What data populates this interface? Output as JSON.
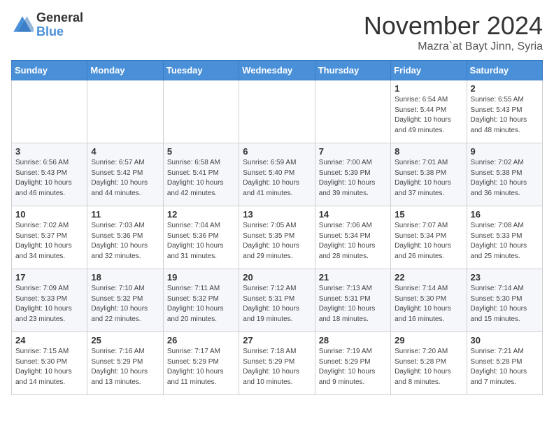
{
  "header": {
    "logo_general": "General",
    "logo_blue": "Blue",
    "month_title": "November 2024",
    "location": "Mazra`at Bayt Jinn, Syria"
  },
  "weekdays": [
    "Sunday",
    "Monday",
    "Tuesday",
    "Wednesday",
    "Thursday",
    "Friday",
    "Saturday"
  ],
  "weeks": [
    [
      {
        "day": "",
        "info": ""
      },
      {
        "day": "",
        "info": ""
      },
      {
        "day": "",
        "info": ""
      },
      {
        "day": "",
        "info": ""
      },
      {
        "day": "",
        "info": ""
      },
      {
        "day": "1",
        "info": "Sunrise: 6:54 AM\nSunset: 5:44 PM\nDaylight: 10 hours\nand 49 minutes."
      },
      {
        "day": "2",
        "info": "Sunrise: 6:55 AM\nSunset: 5:43 PM\nDaylight: 10 hours\nand 48 minutes."
      }
    ],
    [
      {
        "day": "3",
        "info": "Sunrise: 6:56 AM\nSunset: 5:43 PM\nDaylight: 10 hours\nand 46 minutes."
      },
      {
        "day": "4",
        "info": "Sunrise: 6:57 AM\nSunset: 5:42 PM\nDaylight: 10 hours\nand 44 minutes."
      },
      {
        "day": "5",
        "info": "Sunrise: 6:58 AM\nSunset: 5:41 PM\nDaylight: 10 hours\nand 42 minutes."
      },
      {
        "day": "6",
        "info": "Sunrise: 6:59 AM\nSunset: 5:40 PM\nDaylight: 10 hours\nand 41 minutes."
      },
      {
        "day": "7",
        "info": "Sunrise: 7:00 AM\nSunset: 5:39 PM\nDaylight: 10 hours\nand 39 minutes."
      },
      {
        "day": "8",
        "info": "Sunrise: 7:01 AM\nSunset: 5:38 PM\nDaylight: 10 hours\nand 37 minutes."
      },
      {
        "day": "9",
        "info": "Sunrise: 7:02 AM\nSunset: 5:38 PM\nDaylight: 10 hours\nand 36 minutes."
      }
    ],
    [
      {
        "day": "10",
        "info": "Sunrise: 7:02 AM\nSunset: 5:37 PM\nDaylight: 10 hours\nand 34 minutes."
      },
      {
        "day": "11",
        "info": "Sunrise: 7:03 AM\nSunset: 5:36 PM\nDaylight: 10 hours\nand 32 minutes."
      },
      {
        "day": "12",
        "info": "Sunrise: 7:04 AM\nSunset: 5:36 PM\nDaylight: 10 hours\nand 31 minutes."
      },
      {
        "day": "13",
        "info": "Sunrise: 7:05 AM\nSunset: 5:35 PM\nDaylight: 10 hours\nand 29 minutes."
      },
      {
        "day": "14",
        "info": "Sunrise: 7:06 AM\nSunset: 5:34 PM\nDaylight: 10 hours\nand 28 minutes."
      },
      {
        "day": "15",
        "info": "Sunrise: 7:07 AM\nSunset: 5:34 PM\nDaylight: 10 hours\nand 26 minutes."
      },
      {
        "day": "16",
        "info": "Sunrise: 7:08 AM\nSunset: 5:33 PM\nDaylight: 10 hours\nand 25 minutes."
      }
    ],
    [
      {
        "day": "17",
        "info": "Sunrise: 7:09 AM\nSunset: 5:33 PM\nDaylight: 10 hours\nand 23 minutes."
      },
      {
        "day": "18",
        "info": "Sunrise: 7:10 AM\nSunset: 5:32 PM\nDaylight: 10 hours\nand 22 minutes."
      },
      {
        "day": "19",
        "info": "Sunrise: 7:11 AM\nSunset: 5:32 PM\nDaylight: 10 hours\nand 20 minutes."
      },
      {
        "day": "20",
        "info": "Sunrise: 7:12 AM\nSunset: 5:31 PM\nDaylight: 10 hours\nand 19 minutes."
      },
      {
        "day": "21",
        "info": "Sunrise: 7:13 AM\nSunset: 5:31 PM\nDaylight: 10 hours\nand 18 minutes."
      },
      {
        "day": "22",
        "info": "Sunrise: 7:14 AM\nSunset: 5:30 PM\nDaylight: 10 hours\nand 16 minutes."
      },
      {
        "day": "23",
        "info": "Sunrise: 7:14 AM\nSunset: 5:30 PM\nDaylight: 10 hours\nand 15 minutes."
      }
    ],
    [
      {
        "day": "24",
        "info": "Sunrise: 7:15 AM\nSunset: 5:30 PM\nDaylight: 10 hours\nand 14 minutes."
      },
      {
        "day": "25",
        "info": "Sunrise: 7:16 AM\nSunset: 5:29 PM\nDaylight: 10 hours\nand 13 minutes."
      },
      {
        "day": "26",
        "info": "Sunrise: 7:17 AM\nSunset: 5:29 PM\nDaylight: 10 hours\nand 11 minutes."
      },
      {
        "day": "27",
        "info": "Sunrise: 7:18 AM\nSunset: 5:29 PM\nDaylight: 10 hours\nand 10 minutes."
      },
      {
        "day": "28",
        "info": "Sunrise: 7:19 AM\nSunset: 5:29 PM\nDaylight: 10 hours\nand 9 minutes."
      },
      {
        "day": "29",
        "info": "Sunrise: 7:20 AM\nSunset: 5:28 PM\nDaylight: 10 hours\nand 8 minutes."
      },
      {
        "day": "30",
        "info": "Sunrise: 7:21 AM\nSunset: 5:28 PM\nDaylight: 10 hours\nand 7 minutes."
      }
    ]
  ]
}
